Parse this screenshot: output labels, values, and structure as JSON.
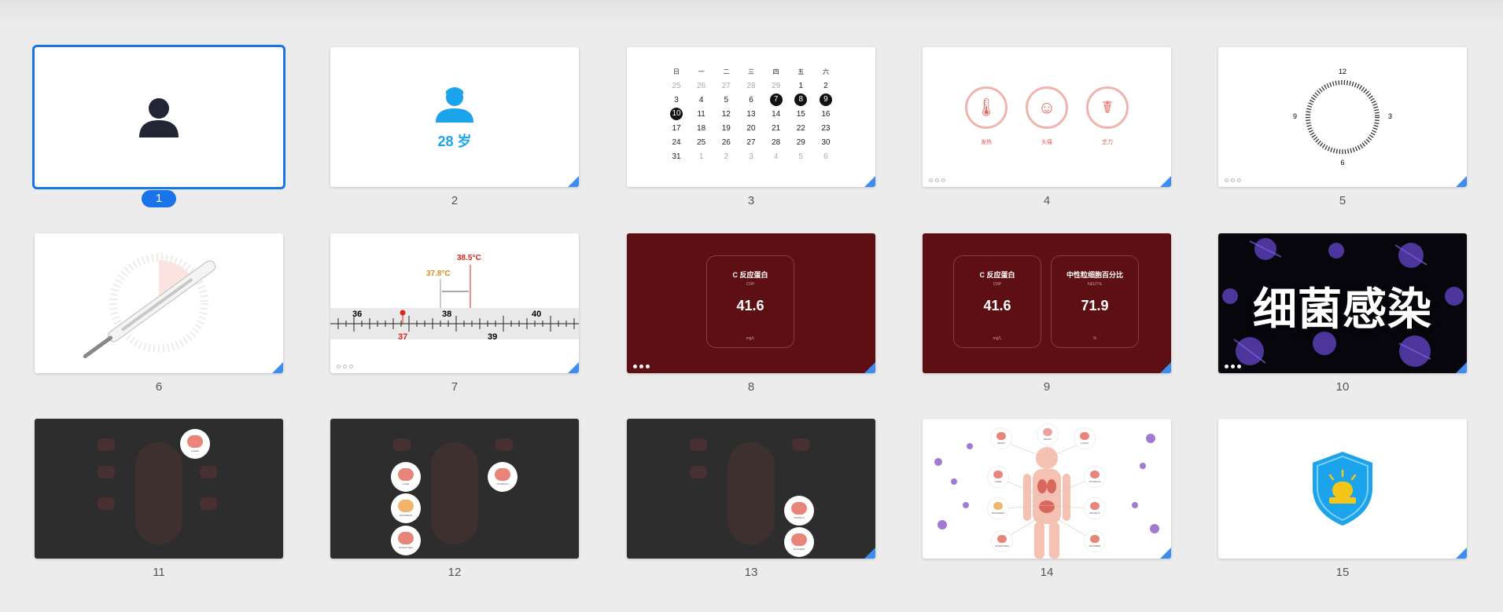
{
  "slides": [
    {
      "number": "1",
      "selected": true
    },
    {
      "number": "2",
      "age_text": "28 岁"
    },
    {
      "number": "3",
      "calendar": {
        "weekdays": [
          "日",
          "一",
          "二",
          "三",
          "四",
          "五",
          "六"
        ],
        "weeks": [
          [
            "25",
            "26",
            "27",
            "28",
            "29",
            "1",
            "2"
          ],
          [
            "3",
            "4",
            "5",
            "6",
            "7",
            "8",
            "9"
          ],
          [
            "10",
            "11",
            "12",
            "13",
            "14",
            "15",
            "16"
          ],
          [
            "17",
            "18",
            "19",
            "20",
            "21",
            "22",
            "23"
          ],
          [
            "24",
            "25",
            "26",
            "27",
            "28",
            "29",
            "30"
          ],
          [
            "31",
            "1",
            "2",
            "3",
            "4",
            "5",
            "6"
          ]
        ],
        "marked": [
          "7",
          "8",
          "9",
          "10"
        ]
      }
    },
    {
      "number": "4",
      "symptoms": [
        "发热",
        "头痛",
        "乏力"
      ]
    },
    {
      "number": "5",
      "clock_labels": {
        "top": "12",
        "right": "3",
        "bottom": "6",
        "left": "9"
      }
    },
    {
      "number": "6"
    },
    {
      "number": "7",
      "readings": {
        "high": "38.5°C",
        "low": "37.8°C"
      },
      "ruler_ticks_top": [
        "36",
        "38",
        "40"
      ],
      "ruler_ticks_bottom": [
        "37",
        "39"
      ]
    },
    {
      "number": "8",
      "cards": [
        {
          "title": "C 反应蛋白",
          "sub": "CRP",
          "value": "41.6",
          "unit": "mg/L"
        }
      ]
    },
    {
      "number": "9",
      "cards": [
        {
          "title": "C 反应蛋白",
          "sub": "CRP",
          "value": "41.6",
          "unit": "mg/L"
        },
        {
          "title": "中性粒细胞百分比",
          "sub": "NEUT%",
          "value": "71.9",
          "unit": "%"
        }
      ]
    },
    {
      "number": "10",
      "headline": "细菌感染"
    },
    {
      "number": "11",
      "organ_labels": [
        "LUNGS"
      ]
    },
    {
      "number": "12",
      "organ_labels": [
        "LIVER",
        "PANCREAS",
        "INTESTINES",
        "STOMACH"
      ]
    },
    {
      "number": "13",
      "organ_labels": [
        "KIDNEYS",
        "BLADDER"
      ]
    },
    {
      "number": "14",
      "organ_labels": [
        "HEART",
        "BRAIN",
        "LUNGS",
        "LIVER",
        "STOMACH",
        "PANCREAS",
        "KIDNEYS",
        "INTESTINES",
        "BLADDER"
      ]
    },
    {
      "number": "15"
    }
  ],
  "colors": {
    "accent": "#1a73e8",
    "dark_red": "#5e0f14",
    "dark_gray": "#2d2d2d",
    "icon_blue": "#1ba3ec"
  }
}
